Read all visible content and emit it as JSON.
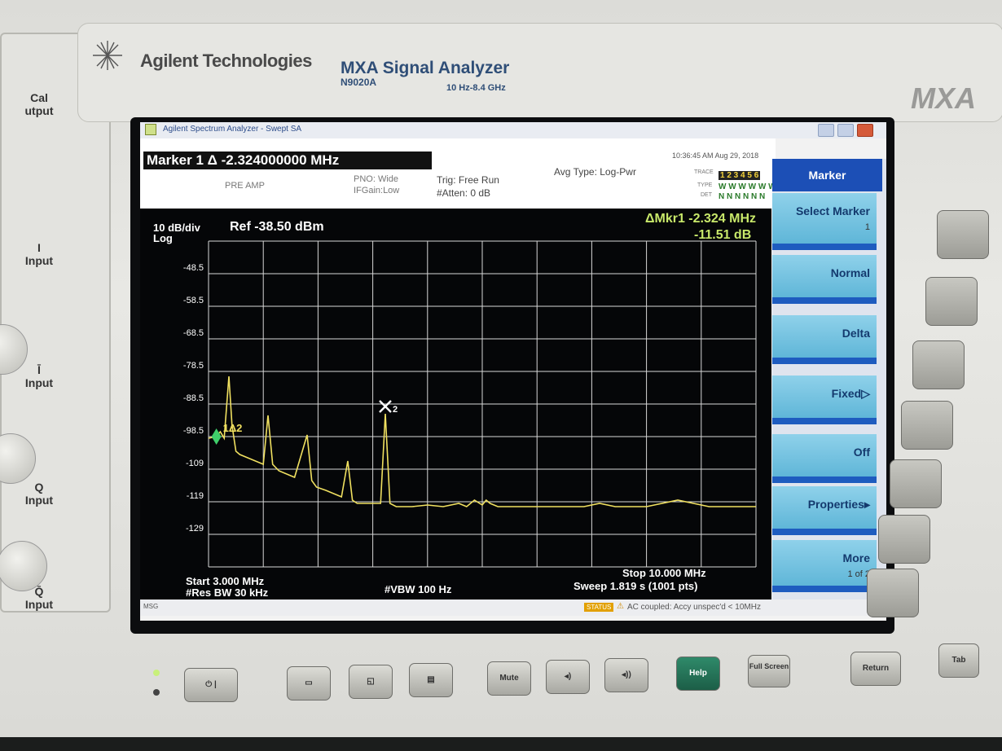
{
  "brand": {
    "company": "Agilent Technologies",
    "product": "MXA Signal Analyzer",
    "model": "N9020A",
    "range": "10 Hz-8.4 GHz",
    "logo": "MXA"
  },
  "left_panel": {
    "labels": [
      "Cal\nOutput",
      "I\nInput",
      "Ī\nInput",
      "Q\nInput",
      "Q̄\nInput"
    ]
  },
  "window": {
    "title": "Agilent Spectrum Analyzer - Swept SA"
  },
  "settings": {
    "marker_readout": "Marker 1 Δ -2.324000000 MHz",
    "pre_amp": "PRE AMP",
    "pno": "PNO: Wide",
    "ifgain": "IFGain:Low",
    "trig": "Trig: Free Run",
    "atten": "#Atten: 0 dB",
    "avg_type": "Avg Type: Log-Pwr",
    "timestamp": "10:36:45 AM Aug 29, 2018",
    "trace_label": "TRACE",
    "type_label": "TYPE",
    "det_label": "DET",
    "trace_nums": "1 2 3 4 5 6",
    "trace_types": "W W W W W W",
    "trace_dets": "N N N N N N"
  },
  "plot": {
    "scale": "10 dB/div",
    "scale_type": "Log",
    "ref_level": "Ref -38.50 dBm",
    "delta_marker": "ΔMkr1 -2.324 MHz",
    "delta_amp": "-11.51 dB",
    "y_ticks": [
      "-48.5",
      "-58.5",
      "-68.5",
      "-78.5",
      "-88.5",
      "-98.5",
      "-109",
      "-119",
      "-129"
    ],
    "marker1_label": "1Δ2",
    "marker2_label": "2",
    "start": "Start 3.000 MHz",
    "stop": "Stop 10.000 MHz",
    "res_bw": "#Res BW 30 kHz",
    "vbw": "#VBW 100 Hz",
    "sweep": "Sweep  1.819 s (1001 pts)"
  },
  "status": {
    "msg": "MSG",
    "badge": "STATUS",
    "text": "AC coupled: Accy unspec'd < 10MHz"
  },
  "menu": {
    "title": "Marker",
    "keys": [
      {
        "label": "Select Marker",
        "sub": "1"
      },
      {
        "label": "Normal",
        "sub": ""
      },
      {
        "label": "Delta",
        "sub": ""
      },
      {
        "label": "Fixed▷",
        "sub": ""
      },
      {
        "label": "Off",
        "sub": ""
      },
      {
        "label": "Properties▸",
        "sub": ""
      },
      {
        "label": "More",
        "sub": "1 of 2"
      }
    ]
  },
  "bottom_keys": {
    "mute": "Mute",
    "help": "Help",
    "full_screen": "Full Screen",
    "return": "Return",
    "tab": "Tab"
  },
  "chart_data": {
    "type": "line",
    "title": "",
    "xlabel": "",
    "ylabel": "",
    "x_unit": "MHz",
    "y_unit": "dBm",
    "xlim": [
      3.0,
      10.0
    ],
    "ylim": [
      -138.5,
      -38.5
    ],
    "grid": true,
    "series": [
      {
        "name": "Trace 1",
        "color": "#f0e060",
        "x": [
          3.0,
          3.1,
          3.15,
          3.2,
          3.26,
          3.3,
          3.35,
          3.4,
          3.5,
          3.7,
          3.76,
          3.82,
          3.9,
          4.1,
          4.26,
          4.32,
          4.38,
          4.5,
          4.7,
          4.78,
          4.84,
          4.9,
          5.2,
          5.26,
          5.32,
          5.4,
          5.6,
          5.8,
          6.0,
          6.2,
          6.3,
          6.4,
          6.5,
          6.55,
          6.6,
          6.7,
          6.8,
          7.0,
          7.2,
          7.4,
          7.6,
          7.8,
          8.0,
          8.2,
          8.6,
          9.0,
          9.4,
          9.8,
          10.0
        ],
        "y": [
          -99,
          -98.5,
          -97,
          -99,
          -80,
          -95,
          -103,
          -104,
          -105,
          -107,
          -92,
          -107,
          -109,
          -111,
          -98,
          -112,
          -114,
          -115,
          -117,
          -106,
          -118,
          -119,
          -119,
          -91.5,
          -119,
          -120,
          -120,
          -119.5,
          -120,
          -119,
          -120,
          -118,
          -119.5,
          -118,
          -119,
          -120,
          -120,
          -120,
          -120,
          -120,
          -120,
          -120,
          -119,
          -120,
          -120,
          -118,
          -120,
          -120,
          -120
        ]
      }
    ],
    "markers": [
      {
        "label": "1Δ2",
        "x": 3.1,
        "y": -98.5
      },
      {
        "label": "2",
        "x": 5.26,
        "y": -91.5
      }
    ]
  }
}
